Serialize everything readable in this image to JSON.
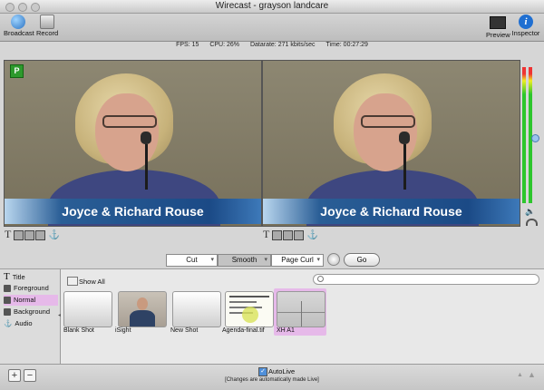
{
  "window": {
    "title": "Wirecast - grayson landcare"
  },
  "toolbar": {
    "broadcast": "Broadcast",
    "record": "Record",
    "preview": "Preview",
    "inspector": "Inspector"
  },
  "stats": {
    "fps": "FPS: 15",
    "cpu": "CPU: 26%",
    "datarate": "Datarate: 271 kbits/sec",
    "time": "Time: 00:27:29"
  },
  "monitors": {
    "preview_badge": "P",
    "lower_third": "Joyce & Richard Rouse"
  },
  "transitions": {
    "cut": "Cut",
    "smooth": "Smooth",
    "page_curl": "Page Curl",
    "go": "Go"
  },
  "layers": [
    {
      "label": "Title",
      "icon": "title-icon"
    },
    {
      "label": "Foreground",
      "icon": "layer-icon"
    },
    {
      "label": "Normal",
      "icon": "layer-icon"
    },
    {
      "label": "Background",
      "icon": "layer-icon"
    },
    {
      "label": "Audio",
      "icon": "audio-icon"
    }
  ],
  "shots": {
    "show_all": "Show All",
    "items": [
      {
        "label": "Blank Shot"
      },
      {
        "label": "iSight"
      },
      {
        "label": "New Shot"
      },
      {
        "label": "Agenda-final.tif"
      },
      {
        "label": "XH A1"
      }
    ]
  },
  "footer": {
    "autolive": "AutoLive",
    "note": "[Changes are automatically made Live]"
  },
  "colors": {
    "selected_layer": "#e6b9e9",
    "lower_third_blue": "#1b4a86",
    "meter_green": "#2cc62c",
    "live_badge": "#2d9a2d"
  }
}
